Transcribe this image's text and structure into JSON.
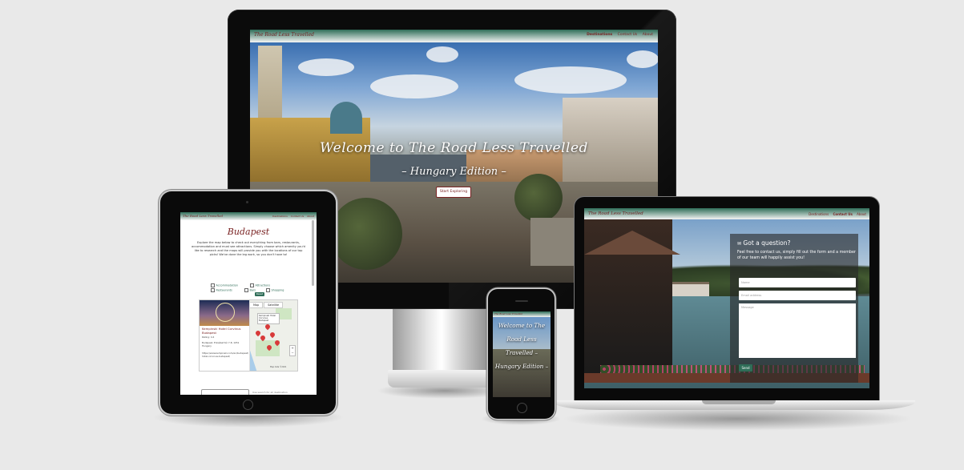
{
  "site": {
    "brand": "The Road Less Travelled",
    "nav": [
      "Destinations",
      "Contact Us",
      "About"
    ]
  },
  "desktop": {
    "hero_title": "Welcome to The Road Less Travelled",
    "hero_subtitle": "– Hungary Edition –",
    "cta": "Start Exploring"
  },
  "tablet": {
    "heading": "Budapest",
    "intro": "Explore the map below to check out everything from bars, restaurants, accommodation and must see attractions. Simply choose which amenity you'd like to research and the maps will provide you with the locations of our top picks! We've done the leg work, so you don't have to!",
    "filters": [
      "Accommodation",
      "Attractions",
      "Restaurants",
      "Bars",
      "Shopping"
    ],
    "reset": "Reset",
    "map_tabs": [
      "Map",
      "Satellite"
    ],
    "place_title": "Kempinski Hotel Corvinus Budapest",
    "place_rating": "Rating: 4.4",
    "place_address": "Budapest, Erzsébet tér 7-8, 1051 Hungary",
    "place_url": "https://www.kempinski.com/en/budapest/hotel-corvinus-budapest/",
    "map_popup": "Kempinski Hotel Corvinus Budapest",
    "attribution": "Map data ©2021",
    "search_note": "Use search for all destination"
  },
  "laptop": {
    "form_heading": "Got a question?",
    "form_text": "Feel free to contact us, simply fill out the form and a member of our team will happily assist you!",
    "name_placeholder": "Name",
    "email_placeholder": "Email address",
    "message_placeholder": "Message",
    "send": "Send"
  },
  "phone": {
    "hero_title": "Welcome to The Road Less Travelled – Hungary Edition –"
  }
}
